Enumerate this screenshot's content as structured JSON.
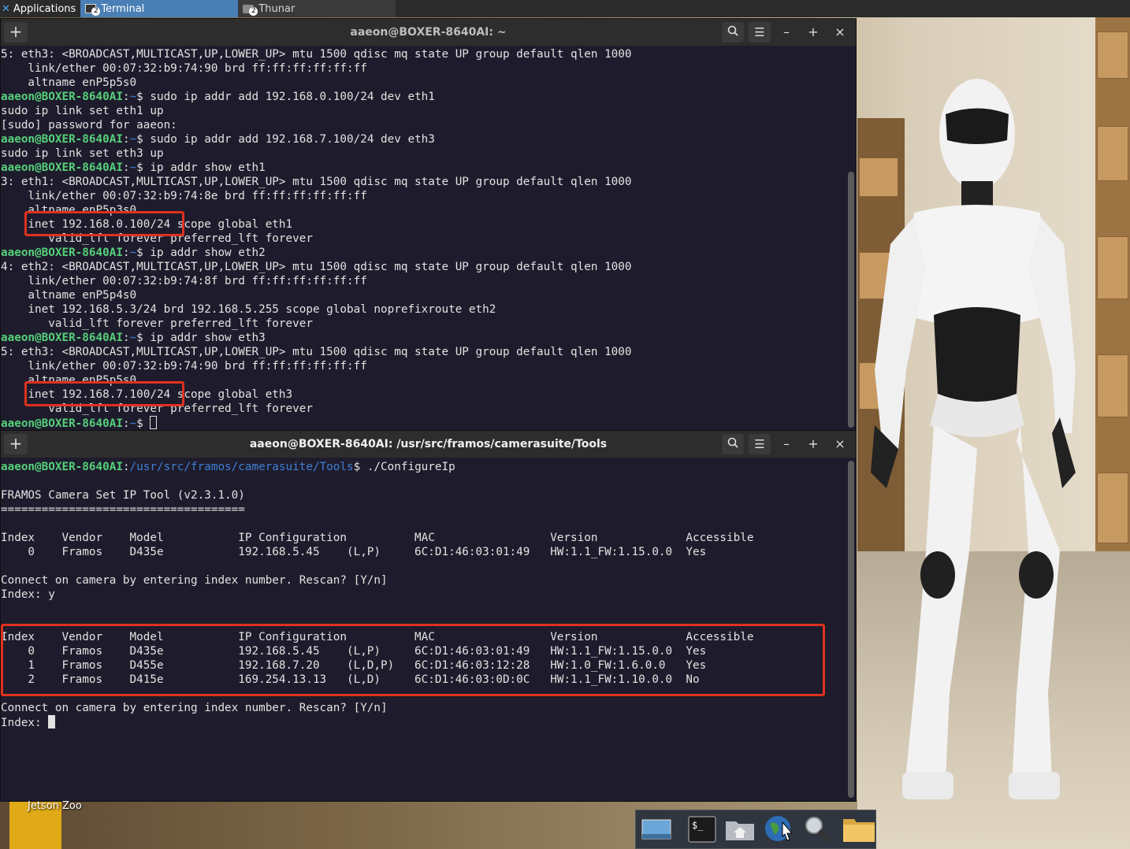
{
  "top_panel": {
    "applications_label": "Applications",
    "tasks": [
      {
        "label": "Terminal",
        "count": "2",
        "active": true
      },
      {
        "label": "Thunar",
        "count": "2",
        "active": false
      }
    ]
  },
  "desktop": {
    "icon_label": "Jetson Zoo"
  },
  "terminal_top": {
    "title": "aaeon@BOXER-8640AI: ~",
    "prompt_user": "aaeon@BOXER-8640AI",
    "prompt_path": "~",
    "lines": [
      {
        "type": "out",
        "text": "5: eth3: <BROADCAST,MULTICAST,UP,LOWER_UP> mtu 1500 qdisc mq state UP group default qlen 1000"
      },
      {
        "type": "out",
        "text": "    link/ether 00:07:32:b9:74:90 brd ff:ff:ff:ff:ff:ff"
      },
      {
        "type": "out",
        "text": "    altname enP5p5s0"
      },
      {
        "type": "cmd",
        "text": "sudo ip addr add 192.168.0.100/24 dev eth1"
      },
      {
        "type": "out",
        "text": "sudo ip link set eth1 up"
      },
      {
        "type": "out",
        "text": "[sudo] password for aaeon:"
      },
      {
        "type": "cmd",
        "text": "sudo ip addr add 192.168.7.100/24 dev eth3"
      },
      {
        "type": "out",
        "text": "sudo ip link set eth3 up"
      },
      {
        "type": "cmd",
        "text": "ip addr show eth1"
      },
      {
        "type": "out",
        "text": "3: eth1: <BROADCAST,MULTICAST,UP,LOWER_UP> mtu 1500 qdisc mq state UP group default qlen 1000"
      },
      {
        "type": "out",
        "text": "    link/ether 00:07:32:b9:74:8e brd ff:ff:ff:ff:ff:ff"
      },
      {
        "type": "out",
        "text": "    altname enP5p3s0"
      },
      {
        "type": "out",
        "text": "    inet 192.168.0.100/24 scope global eth1"
      },
      {
        "type": "out",
        "text": "       valid_lft forever preferred_lft forever"
      },
      {
        "type": "cmd",
        "text": "ip addr show eth2"
      },
      {
        "type": "out",
        "text": "4: eth2: <BROADCAST,MULTICAST,UP,LOWER_UP> mtu 1500 qdisc mq state UP group default qlen 1000"
      },
      {
        "type": "out",
        "text": "    link/ether 00:07:32:b9:74:8f brd ff:ff:ff:ff:ff:ff"
      },
      {
        "type": "out",
        "text": "    altname enP5p4s0"
      },
      {
        "type": "out",
        "text": "    inet 192.168.5.3/24 brd 192.168.5.255 scope global noprefixroute eth2"
      },
      {
        "type": "out",
        "text": "       valid_lft forever preferred_lft forever"
      },
      {
        "type": "cmd",
        "text": "ip addr show eth3"
      },
      {
        "type": "out",
        "text": "5: eth3: <BROADCAST,MULTICAST,UP,LOWER_UP> mtu 1500 qdisc mq state UP group default qlen 1000"
      },
      {
        "type": "out",
        "text": "    link/ether 00:07:32:b9:74:90 brd ff:ff:ff:ff:ff:ff"
      },
      {
        "type": "out",
        "text": "    altname enP5p5s0"
      },
      {
        "type": "out",
        "text": "    inet 192.168.7.100/24 scope global eth3"
      },
      {
        "type": "out",
        "text": "       valid_lft forever preferred_lft forever"
      },
      {
        "type": "prompt",
        "text": ""
      }
    ]
  },
  "terminal_bottom": {
    "title": "aaeon@BOXER-8640AI: /usr/src/framos/camerasuite/Tools",
    "prompt_user": "aaeon@BOXER-8640AI",
    "prompt_path": "/usr/src/framos/camerasuite/Tools",
    "lines": [
      {
        "type": "cmd",
        "text": "./ConfigureIp"
      },
      {
        "type": "out",
        "text": ""
      },
      {
        "type": "out",
        "text": "FRAMOS Camera Set IP Tool (v2.3.1.0)"
      },
      {
        "type": "out",
        "text": "===================================="
      },
      {
        "type": "out",
        "text": ""
      },
      {
        "type": "out",
        "text": "Index    Vendor    Model           IP Configuration          MAC                 Version             Accessible"
      },
      {
        "type": "out",
        "text": "    0    Framos    D435e           192.168.5.45    (L,P)     6C:D1:46:03:01:49   HW:1.1_FW:1.15.0.0  Yes"
      },
      {
        "type": "out",
        "text": ""
      },
      {
        "type": "out",
        "text": "Connect on camera by entering index number. Rescan? [Y/n]"
      },
      {
        "type": "out",
        "text": "Index: y"
      },
      {
        "type": "out",
        "text": ""
      },
      {
        "type": "out",
        "text": ""
      },
      {
        "type": "out",
        "text": "Index    Vendor    Model           IP Configuration          MAC                 Version             Accessible"
      },
      {
        "type": "out",
        "text": "    0    Framos    D435e           192.168.5.45    (L,P)     6C:D1:46:03:01:49   HW:1.1_FW:1.15.0.0  Yes"
      },
      {
        "type": "out",
        "text": "    1    Framos    D455e           192.168.7.20    (L,D,P)   6C:D1:46:03:12:28   HW:1.0_FW:1.6.0.0   Yes"
      },
      {
        "type": "out",
        "text": "    2    Framos    D415e           169.254.13.13   (L,D)     6C:D1:46:03:0D:0C   HW:1.1_FW:1.10.0.0  No"
      },
      {
        "type": "out",
        "text": ""
      },
      {
        "type": "out",
        "text": "Connect on camera by entering index number. Rescan? [Y/n]"
      },
      {
        "type": "input",
        "text": "Index: "
      }
    ]
  },
  "dock": {
    "items": [
      "show-desktop",
      "terminal",
      "home-folder",
      "web-browser",
      "search",
      "files"
    ]
  }
}
